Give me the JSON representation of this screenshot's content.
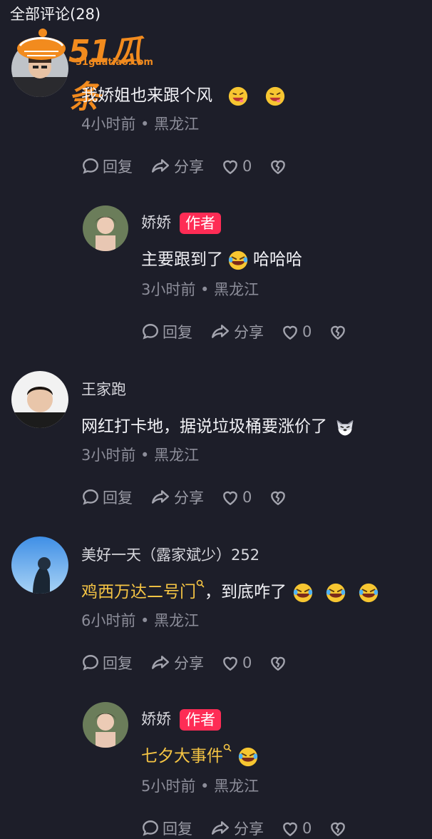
{
  "header": {
    "title": "全部评论(28)"
  },
  "watermark": {
    "brand": "51瓜条",
    "url": "51guatiao.com"
  },
  "comments": [
    {
      "name": "",
      "text": "我娇姐也来跟个风",
      "meta": "4小时前 • 黑龙江",
      "reply": "回复",
      "share": "分享",
      "likes": "0"
    },
    {
      "name": "娇娇",
      "badge": "作者",
      "text": "主要跟到了",
      "text_suffix": "哈哈哈",
      "meta": "3小时前 • 黑龙江",
      "reply": "回复",
      "share": "分享",
      "likes": "0"
    },
    {
      "name": "王家跑",
      "text": "网红打卡地，据说垃圾桶要涨价了",
      "meta": "3小时前 • 黑龙江",
      "reply": "回复",
      "share": "分享",
      "likes": "0"
    },
    {
      "name": "美好一天（露家斌少）252",
      "link": "鸡西万达二号门",
      "text": "，到底咋了",
      "meta": "6小时前 • 黑龙江",
      "reply": "回复",
      "share": "分享",
      "likes": "0"
    },
    {
      "name": "娇娇",
      "badge": "作者",
      "link": "七夕大事件",
      "meta": "5小时前 • 黑龙江",
      "reply": "回复",
      "share": "分享",
      "likes": "0"
    }
  ],
  "colors": {
    "background": "#1d1e29",
    "author_badge": "#fe2c55",
    "link": "#f6c544",
    "meta": "#8c8d99"
  },
  "icons": [
    "reply-icon",
    "share-icon",
    "heart-icon",
    "broken-heart-icon",
    "laughing-crying-emoji",
    "grin-emoji",
    "dog-emoji",
    "search-small-icon"
  ]
}
